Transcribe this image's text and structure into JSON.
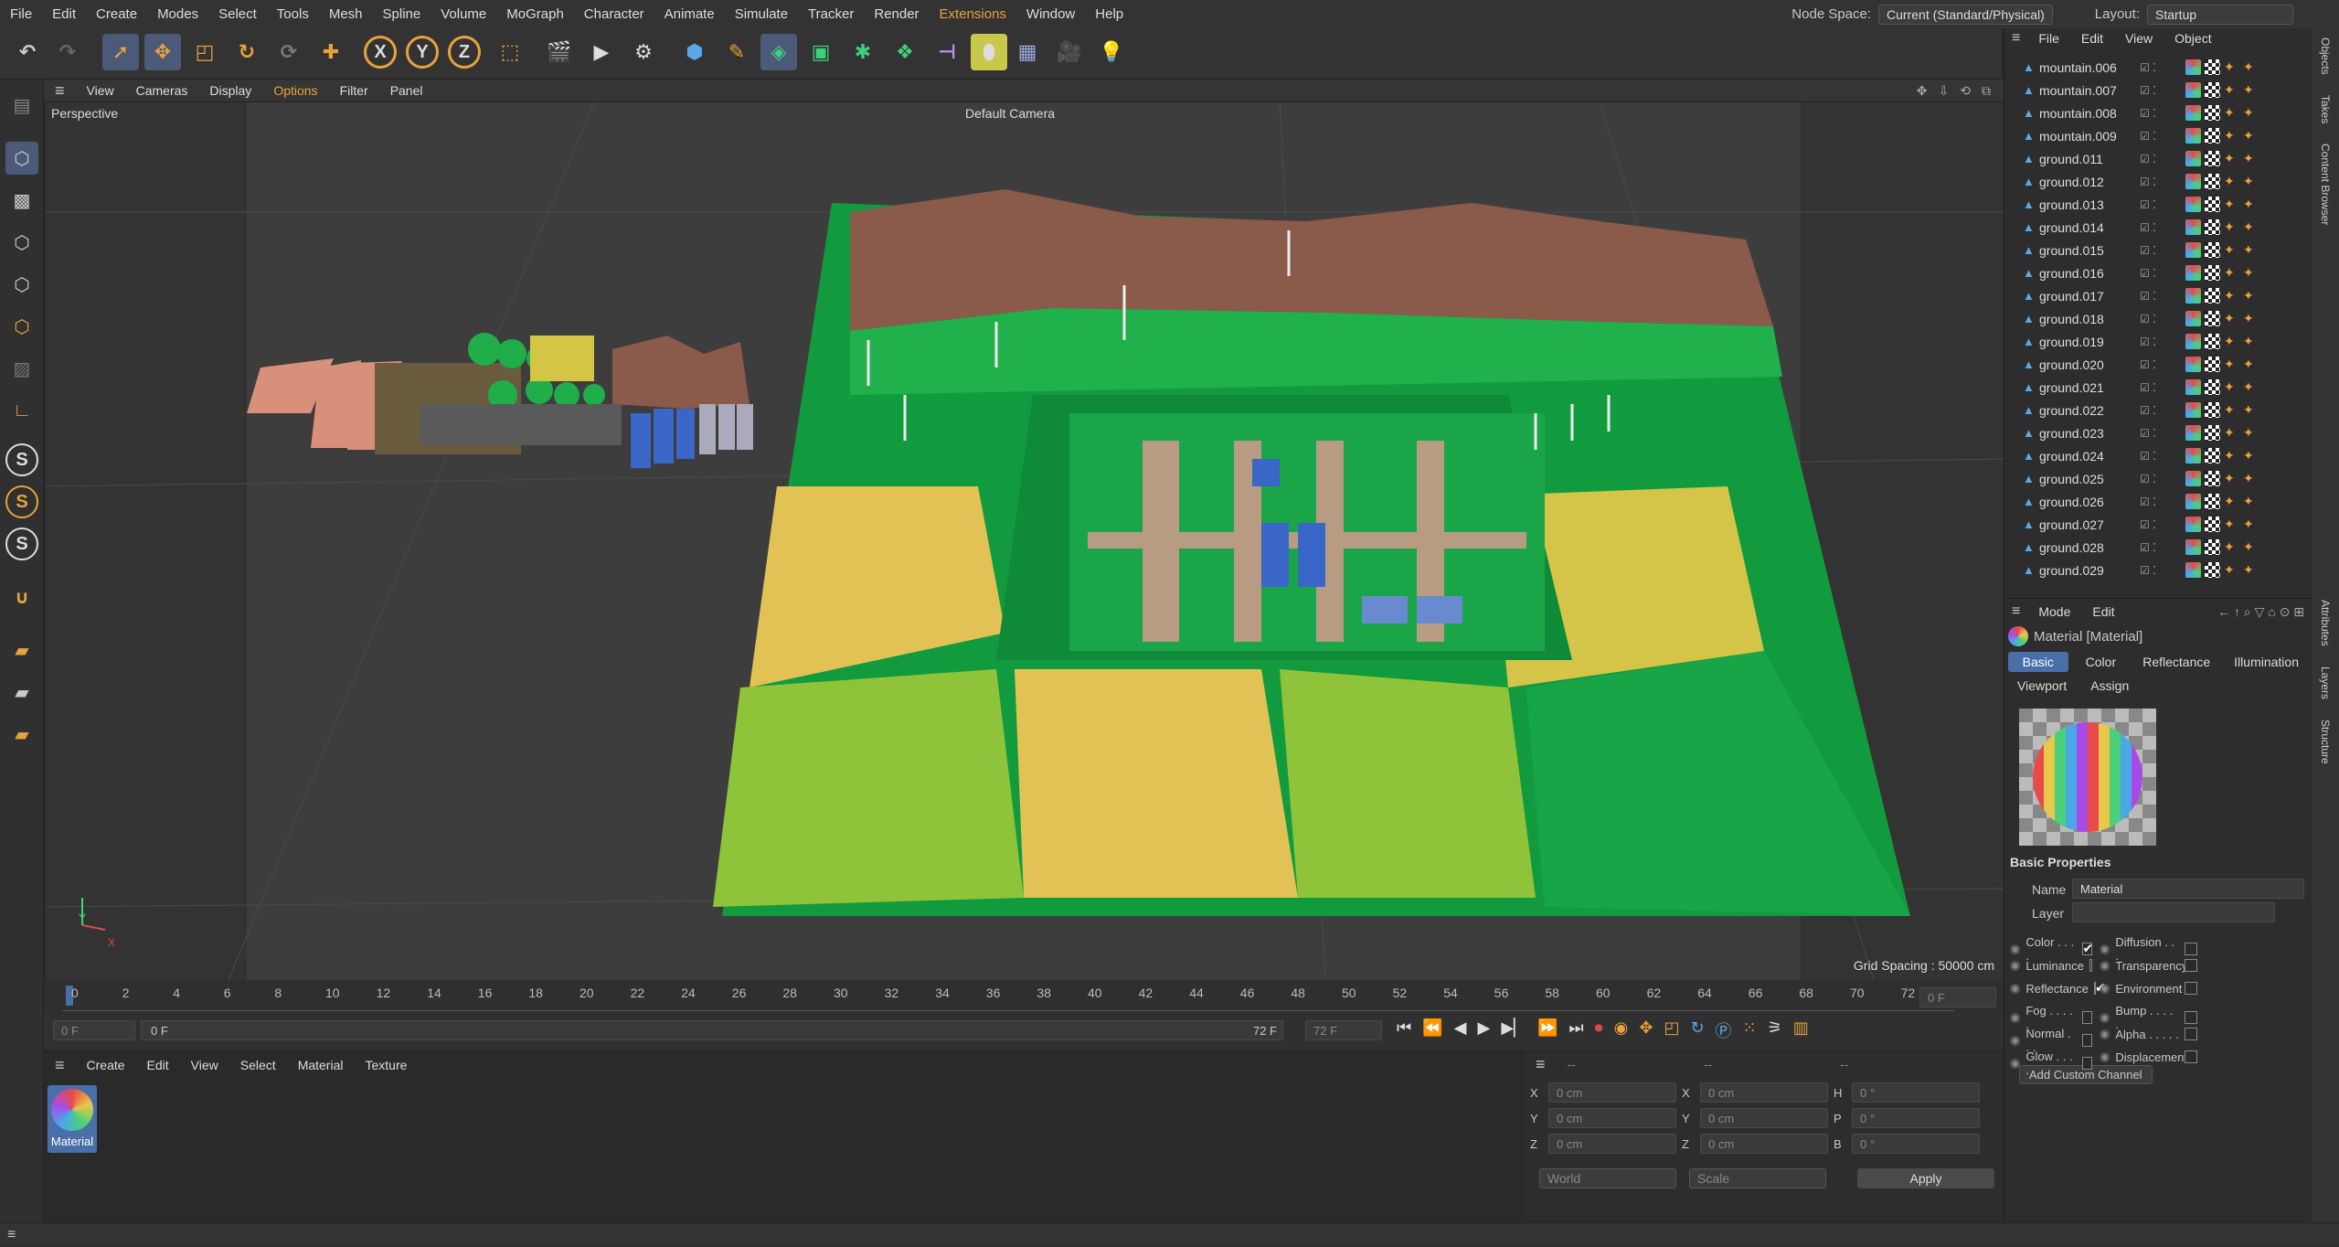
{
  "menubar": {
    "items": [
      "File",
      "Edit",
      "Create",
      "Modes",
      "Select",
      "Tools",
      "Mesh",
      "Spline",
      "Volume",
      "MoGraph",
      "Character",
      "Animate",
      "Simulate",
      "Tracker",
      "Render",
      "Extensions",
      "Window",
      "Help"
    ],
    "node_space_label": "Node Space:",
    "node_space_value": "Current (Standard/Physical)",
    "layout_label": "Layout:",
    "layout_value": "Startup"
  },
  "toolbar": {
    "axis_x": "X",
    "axis_y": "Y",
    "axis_z": "Z"
  },
  "viewport_menu": {
    "items": [
      "View",
      "Cameras",
      "Display",
      "Options",
      "Filter",
      "Panel"
    ]
  },
  "viewport": {
    "view_name": "Perspective",
    "camera_name": "Default Camera",
    "grid_spacing": "Grid Spacing : 50000 cm",
    "axis_y": "Y",
    "axis_x": "X"
  },
  "timeline": {
    "ticks": [
      "0",
      "2",
      "4",
      "6",
      "8",
      "10",
      "12",
      "14",
      "16",
      "18",
      "20",
      "22",
      "24",
      "26",
      "28",
      "30",
      "32",
      "34",
      "36",
      "38",
      "40",
      "42",
      "44",
      "46",
      "48",
      "50",
      "52",
      "54",
      "56",
      "58",
      "60",
      "62",
      "64",
      "66",
      "68",
      "70",
      "72"
    ],
    "current_frame_right": "0 F",
    "start_frame": "0 F",
    "min_frame": "0 F",
    "max_frame": "72 F",
    "end_frame": "72 F"
  },
  "material_manager": {
    "menu": [
      "Create",
      "Edit",
      "View",
      "Select",
      "Material",
      "Texture"
    ],
    "material_name": "Material"
  },
  "coordinates": {
    "header": [
      "--",
      "--",
      "--"
    ],
    "rows": [
      {
        "a": "X",
        "av": "0 cm",
        "b": "X",
        "bv": "0 cm",
        "c": "H",
        "cv": "0 °"
      },
      {
        "a": "Y",
        "av": "0 cm",
        "b": "Y",
        "bv": "0 cm",
        "c": "P",
        "cv": "0 °"
      },
      {
        "a": "Z",
        "av": "0 cm",
        "b": "Z",
        "bv": "0 cm",
        "c": "B",
        "cv": "0 °"
      }
    ],
    "space": "World",
    "mode": "Scale",
    "apply": "Apply"
  },
  "objects_panel": {
    "menu": [
      "File",
      "Edit",
      "View",
      "Object"
    ],
    "items": [
      "mountain.006",
      "mountain.007",
      "mountain.008",
      "mountain.009",
      "ground.011",
      "ground.012",
      "ground.013",
      "ground.014",
      "ground.015",
      "ground.016",
      "ground.017",
      "ground.018",
      "ground.019",
      "ground.020",
      "ground.021",
      "ground.022",
      "ground.023",
      "ground.024",
      "ground.025",
      "ground.026",
      "ground.027",
      "ground.028",
      "ground.029"
    ]
  },
  "attributes": {
    "menu": [
      "Mode",
      "Edit"
    ],
    "title": "Material [Material]",
    "tabs": [
      "Basic",
      "Color",
      "Reflectance",
      "Illumination"
    ],
    "tabs2": [
      "Viewport",
      "Assign"
    ],
    "section": "Basic Properties",
    "name_label": "Name",
    "name_value": "Material",
    "layer_label": "Layer",
    "channels_left": [
      {
        "label": "Color . . . .",
        "on": true
      },
      {
        "label": "Luminance",
        "on": false
      },
      {
        "label": "Reflectance",
        "on": true
      },
      {
        "label": "Fog . . . . .",
        "on": false
      },
      {
        "label": "Normal . . .",
        "on": false
      },
      {
        "label": "Glow . . . .",
        "on": false
      }
    ],
    "channels_right": [
      {
        "label": "Diffusion . . .",
        "on": false
      },
      {
        "label": "Transparency",
        "on": false
      },
      {
        "label": "Environment",
        "on": false
      },
      {
        "label": "Bump . . . . .",
        "on": false
      },
      {
        "label": "Alpha . . . . .",
        "on": false
      },
      {
        "label": "Displacement",
        "on": false
      }
    ],
    "add_channel": "Add Custom Channel"
  },
  "right_strip": [
    "Objects",
    "Takes",
    "Content Browser",
    "Attributes",
    "Layers",
    "Structure"
  ],
  "colors": {
    "accent": "#4a6fa8",
    "highlight": "#e8a23a",
    "grass": "#1fae4a",
    "field_yellow": "#e3c255",
    "mountain": "#8a5a4a"
  }
}
